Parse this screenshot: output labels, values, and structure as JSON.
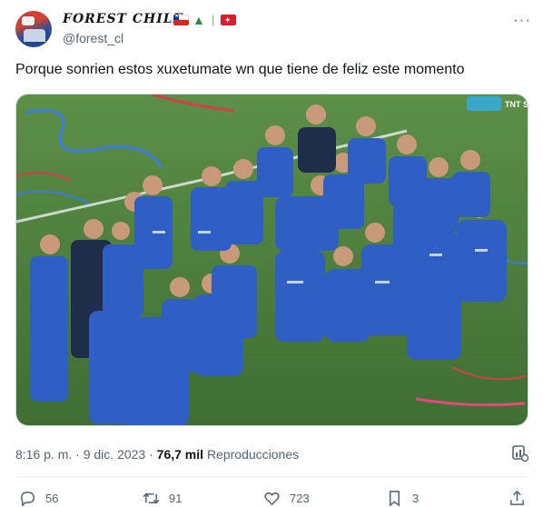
{
  "author": {
    "display_name": "FOREST CHILE",
    "handle": "@forest_cl",
    "badges": [
      "chile-flag-icon",
      "christmas-tree-icon",
      "separator",
      "red-flag-icon"
    ]
  },
  "tweet": {
    "text": "Porque sonrien estos xuxetumate wn que tiene de feliz este momento"
  },
  "media": {
    "type": "photo",
    "overlay_logo": "TNT Sports"
  },
  "meta": {
    "time": "8:16 p. m.",
    "dot": "·",
    "date": "9 dic. 2023",
    "views_count": "76,7 mil",
    "views_label": "Reproducciones"
  },
  "actions": {
    "replies": "56",
    "retweets": "91",
    "likes": "723",
    "bookmarks": "3"
  },
  "colors": {
    "text": "#0f1419",
    "secondary": "#536471",
    "pitch": "#4a7a3a",
    "kit": "#2f5fc4"
  }
}
